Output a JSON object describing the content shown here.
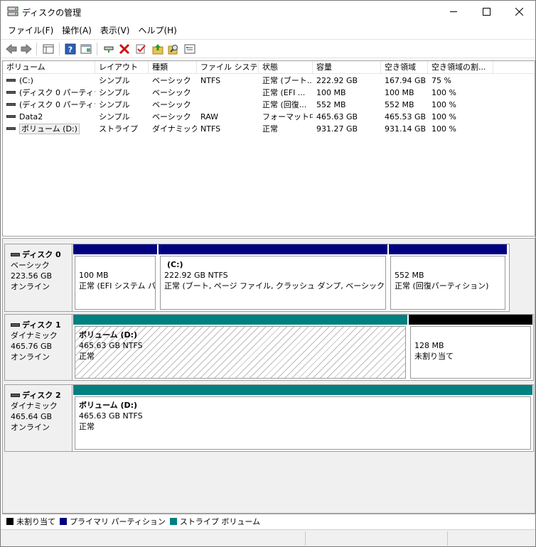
{
  "window": {
    "title": "ディスクの管理"
  },
  "menu": [
    "ファイル(F)",
    "操作(A)",
    "表示(V)",
    "ヘルプ(H)"
  ],
  "toolbar": [
    "back-icon",
    "forward-icon",
    "view-icon",
    "help-icon",
    "properties-icon",
    "connect-icon",
    "delete-icon",
    "check-icon",
    "import-icon",
    "search-icon",
    "settings-icon"
  ],
  "volume_table": {
    "columns": [
      "ボリューム",
      "レイアウト",
      "種類",
      "ファイル システム",
      "状態",
      "容量",
      "空き領域",
      "空き領域の割..."
    ],
    "rows": [
      [
        "(C:)",
        "シンプル",
        "ベーシック",
        "NTFS",
        "正常 (ブート...",
        "222.92 GB",
        "167.94 GB",
        "75 %"
      ],
      [
        "(ディスク 0 パーティシ...",
        "シンプル",
        "ベーシック",
        "",
        "正常 (EFI ...",
        "100 MB",
        "100 MB",
        "100 %"
      ],
      [
        "(ディスク 0 パーティシ...",
        "シンプル",
        "ベーシック",
        "",
        "正常 (回復...",
        "552 MB",
        "552 MB",
        "100 %"
      ],
      [
        "Data2",
        "シンプル",
        "ベーシック",
        "RAW",
        "フォーマット中",
        "465.63 GB",
        "465.53 GB",
        "100 %"
      ],
      [
        "ボリューム (D:)",
        "ストライプ",
        "ダイナミック",
        "NTFS",
        "正常",
        "931.27 GB",
        "931.14 GB",
        "100 %"
      ]
    ]
  },
  "disks": [
    {
      "name": "ディスク 0",
      "type": "ベーシック",
      "size": "223.56 GB",
      "status": "オンライン",
      "partitions": [
        {
          "title": "",
          "size": "100 MB",
          "status": "正常 (EFI システム パー"
        },
        {
          "title": "(C:)",
          "size": "222.92 GB NTFS",
          "status": "正常 (ブート, ページ ファイル, クラッシュ ダンプ, ベーシック データ パー"
        },
        {
          "title": "",
          "size": "552 MB",
          "status": "正常 (回復パーティション)"
        }
      ]
    },
    {
      "name": "ディスク 1",
      "type": "ダイナミック",
      "size": "465.76 GB",
      "status": "オンライン",
      "partitions": [
        {
          "title": "ボリューム  (D:)",
          "size": "465.63 GB NTFS",
          "status": "正常"
        },
        {
          "title": "",
          "size": "128 MB",
          "status": "未割り当て"
        }
      ]
    },
    {
      "name": "ディスク 2",
      "type": "ダイナミック",
      "size": "465.64 GB",
      "status": "オンライン",
      "partitions": [
        {
          "title": "ボリューム  (D:)",
          "size": "465.63 GB NTFS",
          "status": "正常"
        }
      ]
    }
  ],
  "legend": [
    {
      "label": "未割り当て",
      "color": "#000000"
    },
    {
      "label": "プライマリ パーティション",
      "color": "#000080"
    },
    {
      "label": "ストライプ ボリューム",
      "color": "#008080"
    }
  ],
  "colors": {
    "primary": "#000080",
    "stripe": "#008080",
    "unallocated": "#000000"
  }
}
